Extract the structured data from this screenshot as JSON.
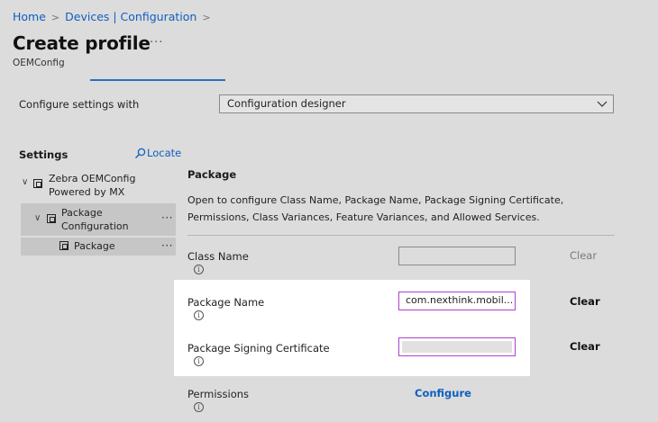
{
  "breadcrumb": {
    "home": "Home",
    "devices": "Devices | Configuration",
    "sep1": ">",
    "sep2": ">"
  },
  "header": {
    "title": "Create profile",
    "more": "···",
    "subtitle": "OEMConfig"
  },
  "config": {
    "label": "Configure settings with",
    "selected": "Configuration designer"
  },
  "settings": {
    "label": "Settings",
    "locate": "Locate",
    "tree": {
      "root_line1": "Zebra OEMConfig",
      "root_line2": "Powered by MX",
      "child_line1": "Package",
      "child_line2": "Configuration",
      "leaf": "Package",
      "more": "···"
    }
  },
  "package": {
    "header": "Package",
    "description": "Open to configure Class Name, Package Name, Package Signing Certificate, Permissions, Class Variances, Feature Variances, and Allowed Services.",
    "fields": {
      "class_name": {
        "label": "Class Name",
        "value": "",
        "clear": "Clear"
      },
      "package_name": {
        "label": "Package Name",
        "value": "com.nexthink.mobil...",
        "clear": "Clear"
      },
      "signing_cert": {
        "label": "Package Signing Certificate",
        "value": "",
        "clear": "Clear"
      },
      "permissions": {
        "label": "Permissions",
        "action": "Configure"
      }
    },
    "info_glyph": "i"
  },
  "colors": {
    "accent": "#0f5fbf",
    "focus_border": "#b03fd0",
    "background": "#dcdcdc"
  }
}
